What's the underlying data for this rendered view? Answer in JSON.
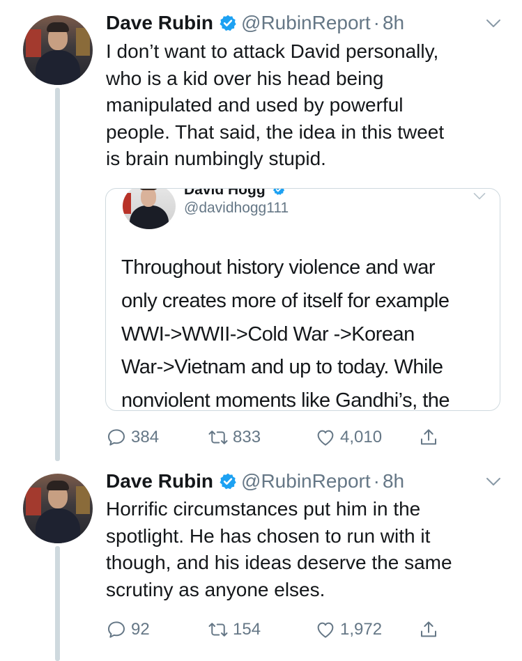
{
  "tweets": [
    {
      "author": {
        "name": "Dave Rubin",
        "handle": "@RubinReport",
        "verified": true
      },
      "separator": "·",
      "time": "8h",
      "text_lines": [
        "I don’t want to attack David personally,",
        "who is a kid over his head being",
        "manipulated and used by powerful",
        "people. That said, the idea in this tweet",
        "is brain numbingly stupid."
      ],
      "quoted": {
        "author_name": "David Hogg",
        "handle": "@davidhogg111",
        "verified": true,
        "text_lines": [
          "Throughout history violence and war",
          "only creates more of itself for example",
          "WWI->WWII->Cold War ->Korean",
          "War->Vietnam and up to today. While",
          "nonviolent moments like Gandhi’s, the"
        ]
      },
      "stats": {
        "replies": "384",
        "retweets": "833",
        "likes": "4,010"
      }
    },
    {
      "author": {
        "name": "Dave Rubin",
        "handle": "@RubinReport",
        "verified": true
      },
      "separator": "·",
      "time": "8h",
      "text_lines": [
        "Horrific circumstances put him in the",
        "spotlight. He has chosen to run with it",
        "though, and his ideas deserve the same",
        "scrutiny as anyone elses."
      ],
      "stats": {
        "replies": "92",
        "retweets": "154",
        "likes": "1,972"
      }
    }
  ],
  "icons": {
    "verified": "verified-badge-icon",
    "menu": "chevron-down-icon",
    "reply": "reply-icon",
    "retweet": "retweet-icon",
    "like": "heart-icon",
    "share": "share-icon"
  },
  "colors": {
    "text": "#14171a",
    "secondary": "#657786",
    "verified": "#1da1f2",
    "thread_line": "#cfd9de",
    "border": "#cfd9de"
  }
}
